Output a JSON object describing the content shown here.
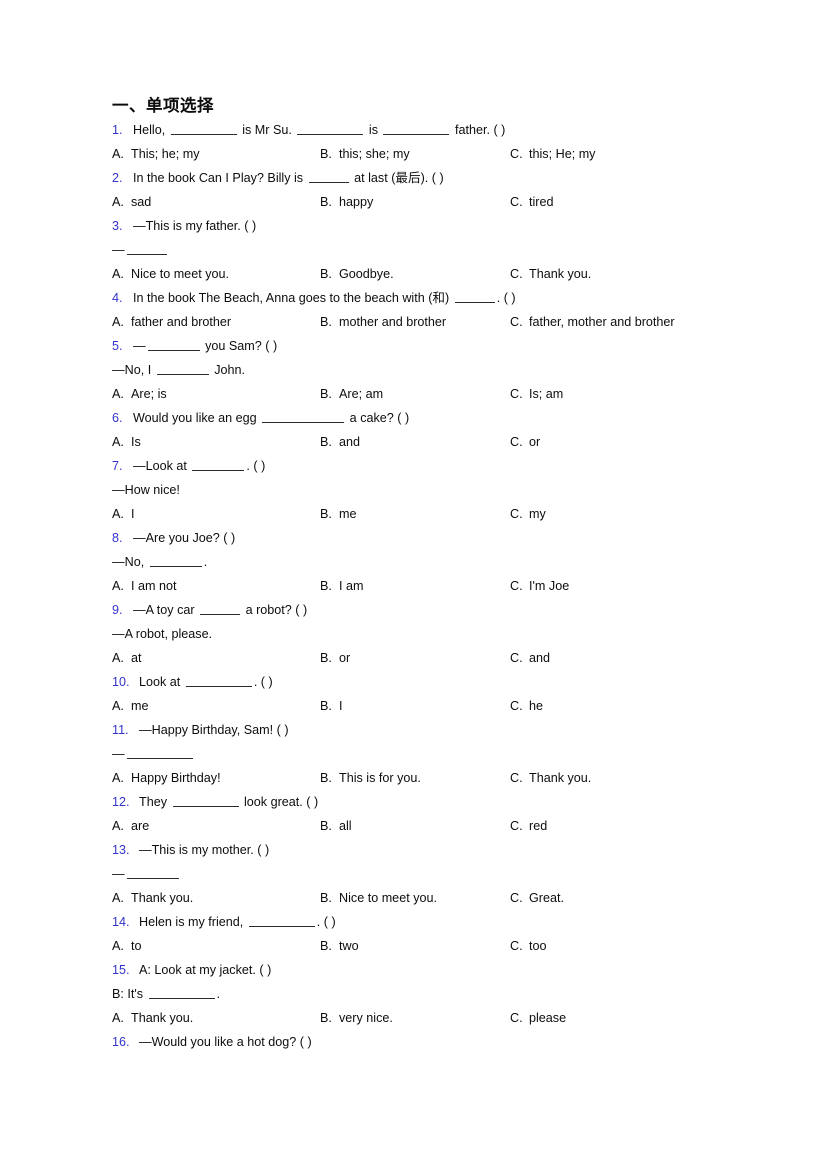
{
  "document": {
    "section_title": "一、单项选择",
    "blank_marker": "____",
    "paren_marker": "(  )"
  },
  "questions": [
    {
      "number": "1.",
      "stem_parts": [
        "Hello, ",
        "BLANK_XL",
        " is Mr Su. ",
        "BLANK_XL",
        " is ",
        "BLANK_LG",
        " father. (  )"
      ],
      "stem_text": "Hello, ________ is Mr Su. ________ is ________ father. (  )",
      "continuation": null,
      "options": [
        {
          "letter": "A.",
          "text": "This; he; my"
        },
        {
          "letter": "B.",
          "text": "this; she; my"
        },
        {
          "letter": "C.",
          "text": "this; He; my"
        }
      ]
    },
    {
      "number": "2.",
      "stem_text": "In the book Can I Play? Billy is ____ at last (最后). (   )",
      "continuation": null,
      "options": [
        {
          "letter": "A.",
          "text": "sad"
        },
        {
          "letter": "B.",
          "text": "happy"
        },
        {
          "letter": "C.",
          "text": "tired"
        }
      ]
    },
    {
      "number": "3.",
      "stem_text": "—This is my father. (   )",
      "continuation": "—_____",
      "options": [
        {
          "letter": "A.",
          "text": "Nice to meet you."
        },
        {
          "letter": "B.",
          "text": "Goodbye."
        },
        {
          "letter": "C.",
          "text": "Thank you."
        }
      ]
    },
    {
      "number": "4.",
      "stem_text": "In the book The Beach, Anna goes to the beach with (和) _____. (  )",
      "continuation": null,
      "options": [
        {
          "letter": "A.",
          "text": "father and brother"
        },
        {
          "letter": "B.",
          "text": "mother and brother"
        },
        {
          "letter": "C.",
          "text": "father, mother and brother"
        }
      ]
    },
    {
      "number": "5.",
      "stem_text": "—______ you Sam? (  )",
      "continuation": "—No, I ______ John.",
      "options": [
        {
          "letter": "A.",
          "text": "Are; is"
        },
        {
          "letter": "B.",
          "text": "Are; am"
        },
        {
          "letter": "C.",
          "text": "Is; am"
        }
      ]
    },
    {
      "number": "6.",
      "stem_text": "Would you like an egg __________ a cake? (  )",
      "continuation": null,
      "options": [
        {
          "letter": "A.",
          "text": "Is"
        },
        {
          "letter": "B.",
          "text": "and"
        },
        {
          "letter": "C.",
          "text": "or"
        }
      ]
    },
    {
      "number": "7.",
      "stem_text": "—Look at _______. (  )",
      "continuation": "—How nice!",
      "options": [
        {
          "letter": "A.",
          "text": "I"
        },
        {
          "letter": "B.",
          "text": "me"
        },
        {
          "letter": "C.",
          "text": "my"
        }
      ]
    },
    {
      "number": "8.",
      "stem_text": "—Are you Joe? (  )",
      "continuation": "—No, ______.",
      "options": [
        {
          "letter": "A.",
          "text": "I am not"
        },
        {
          "letter": "B.",
          "text": "I am"
        },
        {
          "letter": "C.",
          "text": "I'm Joe"
        }
      ]
    },
    {
      "number": "9.",
      "stem_text": "—A toy car _____ a robot? (  )",
      "continuation": "—A robot, please.",
      "options": [
        {
          "letter": "A.",
          "text": "at"
        },
        {
          "letter": "B.",
          "text": "or"
        },
        {
          "letter": "C.",
          "text": "and"
        }
      ]
    },
    {
      "number": "10.",
      "stem_text": "Look at ________. (    )",
      "continuation": null,
      "options": [
        {
          "letter": "A.",
          "text": "me"
        },
        {
          "letter": "B.",
          "text": "I"
        },
        {
          "letter": "C.",
          "text": "he"
        }
      ]
    },
    {
      "number": "11.",
      "stem_text": "—Happy Birthday, Sam! ( )",
      "continuation": "—________",
      "options": [
        {
          "letter": "A.",
          "text": "Happy Birthday!"
        },
        {
          "letter": "B.",
          "text": "This is for you."
        },
        {
          "letter": "C.",
          "text": "Thank you."
        }
      ]
    },
    {
      "number": "12.",
      "stem_text": "They ________ look great. (  )",
      "continuation": null,
      "options": [
        {
          "letter": "A.",
          "text": "are"
        },
        {
          "letter": "B.",
          "text": "all"
        },
        {
          "letter": "C.",
          "text": "red"
        }
      ]
    },
    {
      "number": "13.",
      "stem_text": "—This is my mother. (  )",
      "continuation": "—______",
      "options": [
        {
          "letter": "A.",
          "text": "Thank you."
        },
        {
          "letter": "B.",
          "text": "Nice to meet you."
        },
        {
          "letter": "C.",
          "text": "Great."
        }
      ]
    },
    {
      "number": "14.",
      "stem_text": "Helen is my friend, ________. (  )",
      "continuation": null,
      "options": [
        {
          "letter": "A.",
          "text": "to"
        },
        {
          "letter": "B.",
          "text": "two"
        },
        {
          "letter": "C.",
          "text": "too"
        }
      ]
    },
    {
      "number": "15.",
      "stem_text": "A: Look at my jacket. (  )",
      "continuation": "B: It's ________.",
      "options": [
        {
          "letter": "A.",
          "text": "Thank you."
        },
        {
          "letter": "B.",
          "text": "very nice."
        },
        {
          "letter": "C.",
          "text": "please"
        }
      ]
    },
    {
      "number": "16.",
      "stem_text": "—Would you like a hot dog? (   )",
      "continuation": null,
      "options": []
    }
  ],
  "colors": {
    "question_number": "#3333cc",
    "body_text": "#0d0d0d",
    "page_background": "#ffffff"
  }
}
